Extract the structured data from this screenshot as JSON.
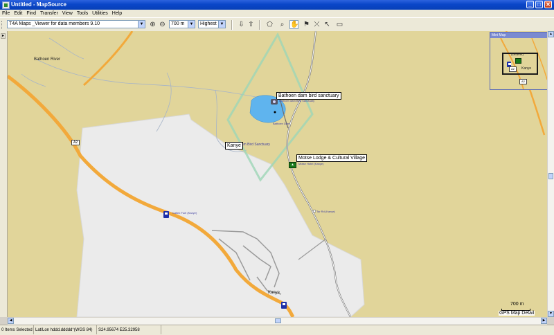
{
  "window": {
    "title": "Untitled - MapSource",
    "min": "_",
    "max": "□",
    "close": "✕"
  },
  "menu": [
    "File",
    "Edit",
    "Find",
    "Transfer",
    "View",
    "Tools",
    "Utilities",
    "Help"
  ],
  "toolbar": {
    "product_select": "T4A Maps _Viewer for data members 9.10",
    "zoom_in_icon": "zoom-in-icon",
    "zoom_out_icon": "zoom-out-icon",
    "scale_select": "700 m",
    "detail_select": "Highest"
  },
  "map": {
    "labels": {
      "bathoen_river": "Bathoen River",
      "bathoen_sanctuary": "Bathoen dam bird sanctuary",
      "bathoen_sanctuary_sub": "Bathoen dam Bird Sanctuary",
      "bathoen_dam": "Bathoen Dam",
      "dam_bird_sanctuary": "n Dam Bird Sanctuary",
      "kanye_box": "Kanye",
      "motse_lodge": "Motse Lodge & Cultural Village",
      "motse_hotel": "Motse Hotel (Kanye)",
      "tar_road": "Tar Rd (Kanye)",
      "caltex_fuel": "Caltex Fuel (Kanye)",
      "kanye_town": "Kanye",
      "road_a2": "A2"
    },
    "scale_label": "700 m",
    "detail_label": "GPS Map Detail",
    "overview": {
      "title": "Mini Map",
      "gravel": "(Gravel)",
      "kanye": "Kanye",
      "a2_upper": "A2",
      "a2_lower": "A2"
    }
  },
  "statusbar": {
    "selection": "0 Items Selected",
    "coord_format": "Lat/Lon hddd.ddddd°(WGS 84)",
    "coords": "S24.95674 E25.32958"
  },
  "colors": {
    "land": "#e1d59a",
    "urban": "#ebebeb",
    "major_road": "#f2a93b",
    "water": "#5fb4ee",
    "sanctuary_outline": "#9dd6b6",
    "titlebar": "#0a46c8"
  }
}
